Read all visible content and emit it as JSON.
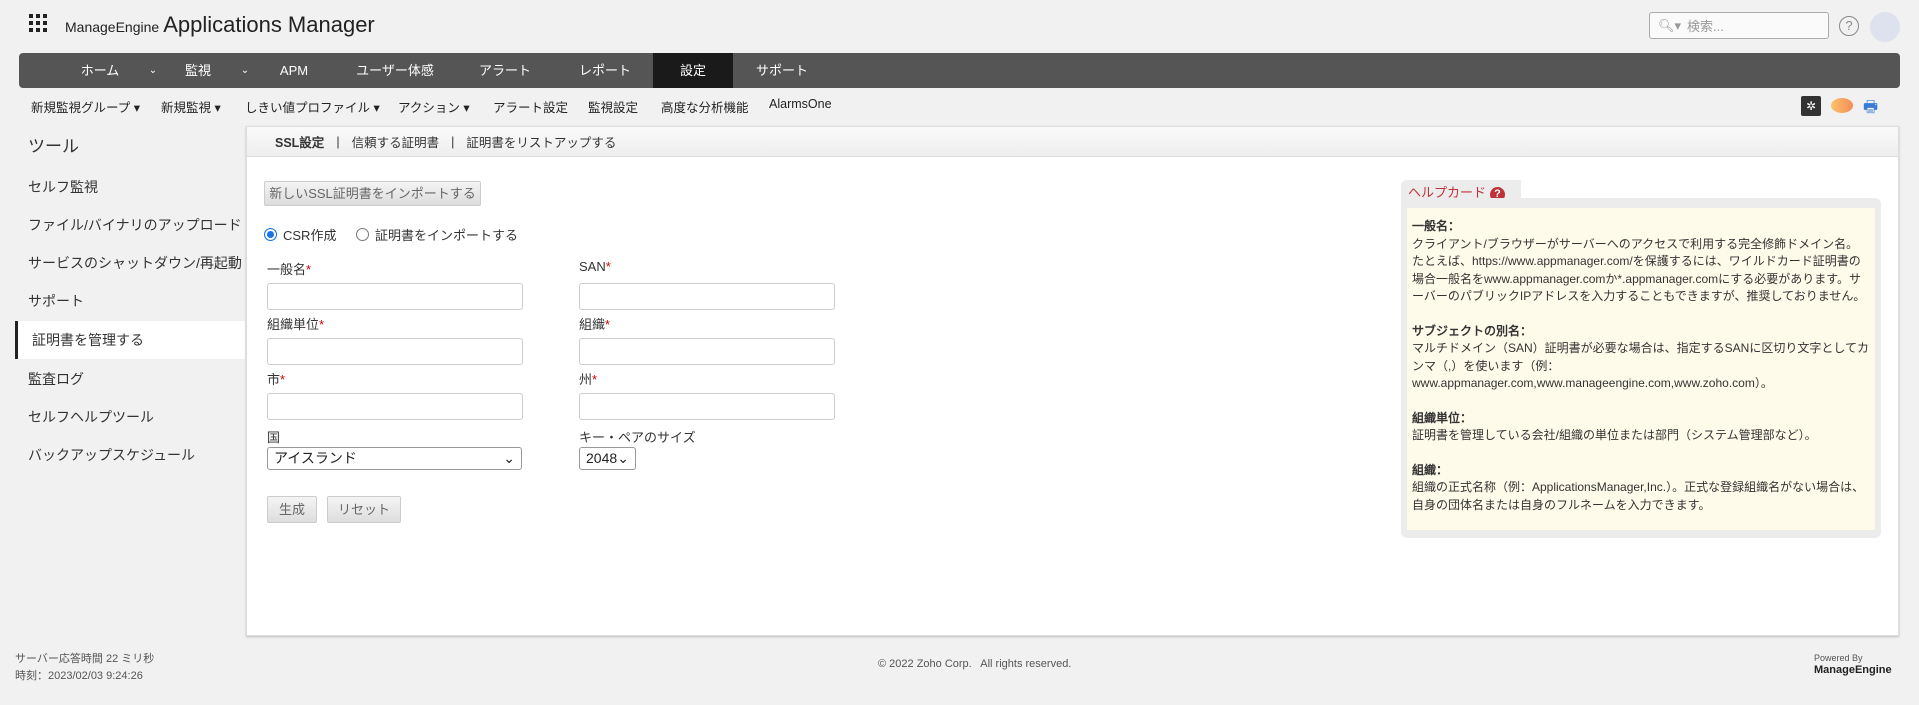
{
  "header": {
    "brand_small": "ManageEngine",
    "brand_title": "Applications Manager",
    "search_placeholder": "検索...",
    "help": "?"
  },
  "nav": {
    "items": [
      "ホーム",
      "監視",
      "APM",
      "ユーザー体感",
      "アラート",
      "レポート",
      "設定",
      "サポート"
    ],
    "active": "設定"
  },
  "subnav": [
    "新規監視グループ ▾",
    "新規監視 ▾",
    "しきい値プロファイル ▾",
    "アクション ▾",
    "アラート設定",
    "監視設定",
    "高度な分析機能",
    "AlarmsOne"
  ],
  "sidebar": {
    "title": "ツール",
    "items": [
      "セルフ監視",
      "ファイル/バイナリのアップロード",
      "サービスのシャットダウン/再起動",
      "サポート",
      "証明書を管理する",
      "監査ログ",
      "セルフヘルプツール",
      "バックアップスケジュール"
    ],
    "active": "証明書を管理する"
  },
  "tabs": [
    "SSL設定",
    "信頼する証明書",
    "証明書をリストアップする"
  ],
  "tab_sep": "|",
  "form": {
    "import_button": "新しいSSL証明書をインポートする",
    "radio_csr": "CSR作成",
    "radio_import": "証明書をインポートする",
    "common_name": "一般名",
    "san": "SAN",
    "org_unit": "組織単位",
    "org": "組織",
    "city": "市",
    "state": "州",
    "country": "国",
    "country_value": "アイスランド",
    "key_size_label": "キー・ペアのサイズ",
    "key_size_value": "2048",
    "required": "*",
    "generate": "生成",
    "reset": "リセット"
  },
  "helpcard": {
    "title": "ヘルプカード",
    "sections": [
      {
        "h": "一般名：",
        "t": "クライアント/ブラウザーがサーバーへのアクセスで利用する完全修飾ドメイン名。たとえば、https://www.appmanager.com/を保護するには、ワイルドカード証明書の場合一般名をwww.appmanager.comか*.appmanager.comにする必要があります。サーバーのパブリックIPアドレスを入力することもできますが、推奨しておりません。"
      },
      {
        "h": "サブジェクトの別名：",
        "t": "マルチドメイン（SAN）証明書が必要な場合は、指定するSANに区切り文字としてカンマ（,）を使います（例：www.appmanager.com,www.manageengine.com,www.zoho.com）。"
      },
      {
        "h": "組織単位：",
        "t": "証明書を管理している会社/組織の単位または部門（システム管理部など）。"
      },
      {
        "h": "組織：",
        "t": "組織の正式名称（例：ApplicationsManager,Inc.）。正式な登録組織名がない場合は、自身の団体名または自身のフルネームを入力できます。"
      }
    ]
  },
  "footer": {
    "response": "サーバー応答時間 22 ミリ秒",
    "time": "時刻：2023/02/03 9:24:26",
    "copyright": "© 2022 Zoho Corp.   All rights reserved.",
    "powered": "Powered By",
    "powered_brand": "ManageEngine"
  }
}
